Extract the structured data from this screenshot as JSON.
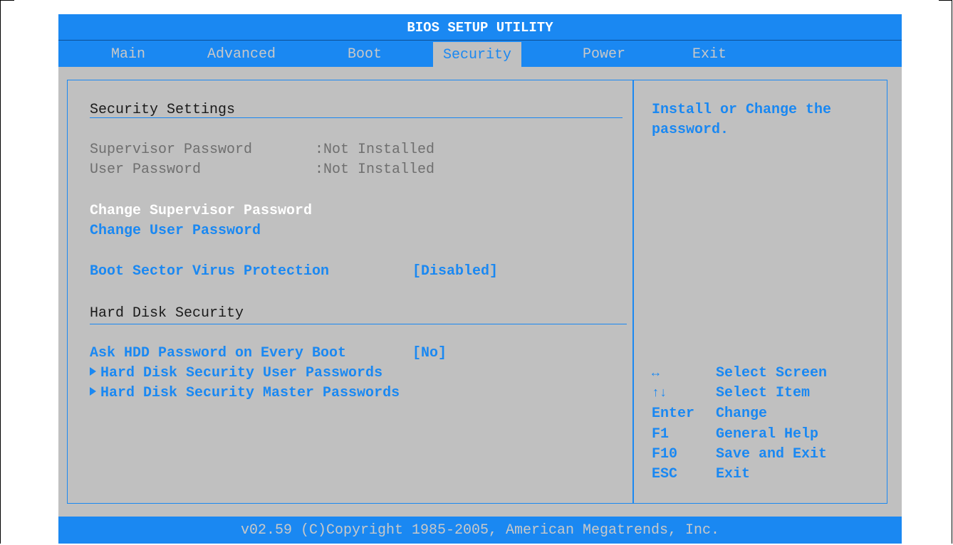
{
  "title": "BIOS SETUP UTILITY",
  "tabs": [
    {
      "label": "Main"
    },
    {
      "label": "Advanced"
    },
    {
      "label": "Boot"
    },
    {
      "label": "Security"
    },
    {
      "label": "Power"
    },
    {
      "label": "Exit"
    }
  ],
  "active_tab": "Security",
  "main": {
    "section1_heading": "Security Settings",
    "supervisor_password": {
      "label": "Supervisor Password",
      "value": ":Not Installed"
    },
    "user_password": {
      "label": "User Password",
      "value": ":Not Installed"
    },
    "change_supervisor_password": "Change Supervisor Password",
    "change_user_password": "Change User Password",
    "boot_sector_virus": {
      "label": "Boot Sector Virus Protection",
      "value": "[Disabled]"
    },
    "section2_heading": "Hard Disk Security",
    "ask_hdd_password": {
      "label": "Ask HDD Password on Every Boot",
      "value": "[No]"
    },
    "hdd_user_passwords": "Hard Disk Security User Passwords",
    "hdd_master_passwords": "Hard Disk Security Master Passwords"
  },
  "help": {
    "line1": "Install or Change the",
    "line2": "password.",
    "keys": [
      {
        "key": "↔",
        "desc": "Select Screen"
      },
      {
        "key": "↑↓",
        "desc": "Select Item"
      },
      {
        "key": "Enter",
        "desc": "Change"
      },
      {
        "key": "F1",
        "desc": "General Help"
      },
      {
        "key": "F10",
        "desc": "Save and Exit"
      },
      {
        "key": "ESC",
        "desc": "Exit"
      }
    ]
  },
  "footer": "v02.59 (C)Copyright 1985-2005, American Megatrends, Inc.",
  "colors": {
    "accent": "#1a88f2",
    "panel": "#c0c0c0",
    "highlight": "#ffffff",
    "disabled": "#6f6f6f"
  }
}
